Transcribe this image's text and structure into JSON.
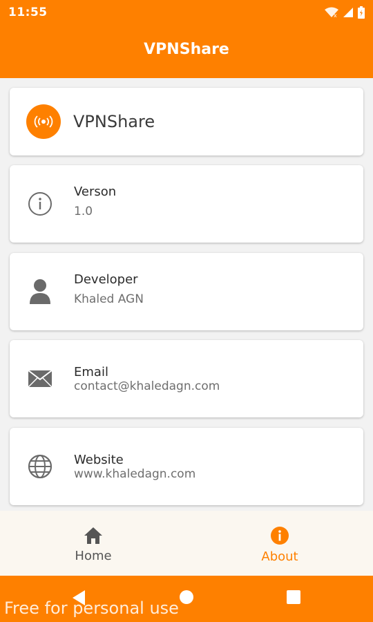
{
  "status": {
    "time": "11:55"
  },
  "appbar": {
    "title": "VPNShare"
  },
  "header_card": {
    "title": "VPNShare",
    "icon": "broadcast-icon"
  },
  "info_cards": [
    {
      "label": "Verson",
      "value": "1.0",
      "icon": "info-circle-icon"
    },
    {
      "label": "Developer",
      "value": "Khaled AGN",
      "icon": "person-icon"
    },
    {
      "label": "Email",
      "value": "contact@khaledagn.com",
      "icon": "envelope-icon"
    },
    {
      "label": "Website",
      "value": "www.khaledagn.com",
      "icon": "globe-icon"
    }
  ],
  "bottom_nav": {
    "items": [
      {
        "label": "Home",
        "icon": "home-icon",
        "active": false
      },
      {
        "label": "About",
        "icon": "info-filled-icon",
        "active": true
      }
    ]
  },
  "watermark": "Free for personal use",
  "colors": {
    "accent": "#fe8000",
    "background": "#f2f2f2",
    "nav_background": "#fbf7f0"
  }
}
